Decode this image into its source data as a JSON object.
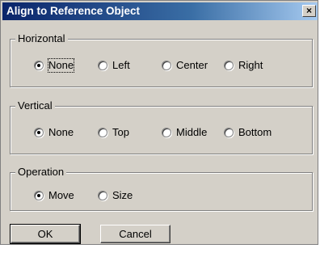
{
  "window": {
    "title": "Align to Reference Object",
    "close_glyph": "×"
  },
  "groups": {
    "horizontal": {
      "label": "Horizontal",
      "options": [
        {
          "label": "None",
          "checked": true
        },
        {
          "label": "Left",
          "checked": false
        },
        {
          "label": "Center",
          "checked": false
        },
        {
          "label": "Right",
          "checked": false
        }
      ]
    },
    "vertical": {
      "label": "Vertical",
      "options": [
        {
          "label": "None",
          "checked": true
        },
        {
          "label": "Top",
          "checked": false
        },
        {
          "label": "Middle",
          "checked": false
        },
        {
          "label": "Bottom",
          "checked": false
        }
      ]
    },
    "operation": {
      "label": "Operation",
      "options": [
        {
          "label": "Move",
          "checked": true
        },
        {
          "label": "Size",
          "checked": false
        }
      ]
    }
  },
  "buttons": {
    "ok_label": "OK",
    "cancel_label": "Cancel"
  }
}
